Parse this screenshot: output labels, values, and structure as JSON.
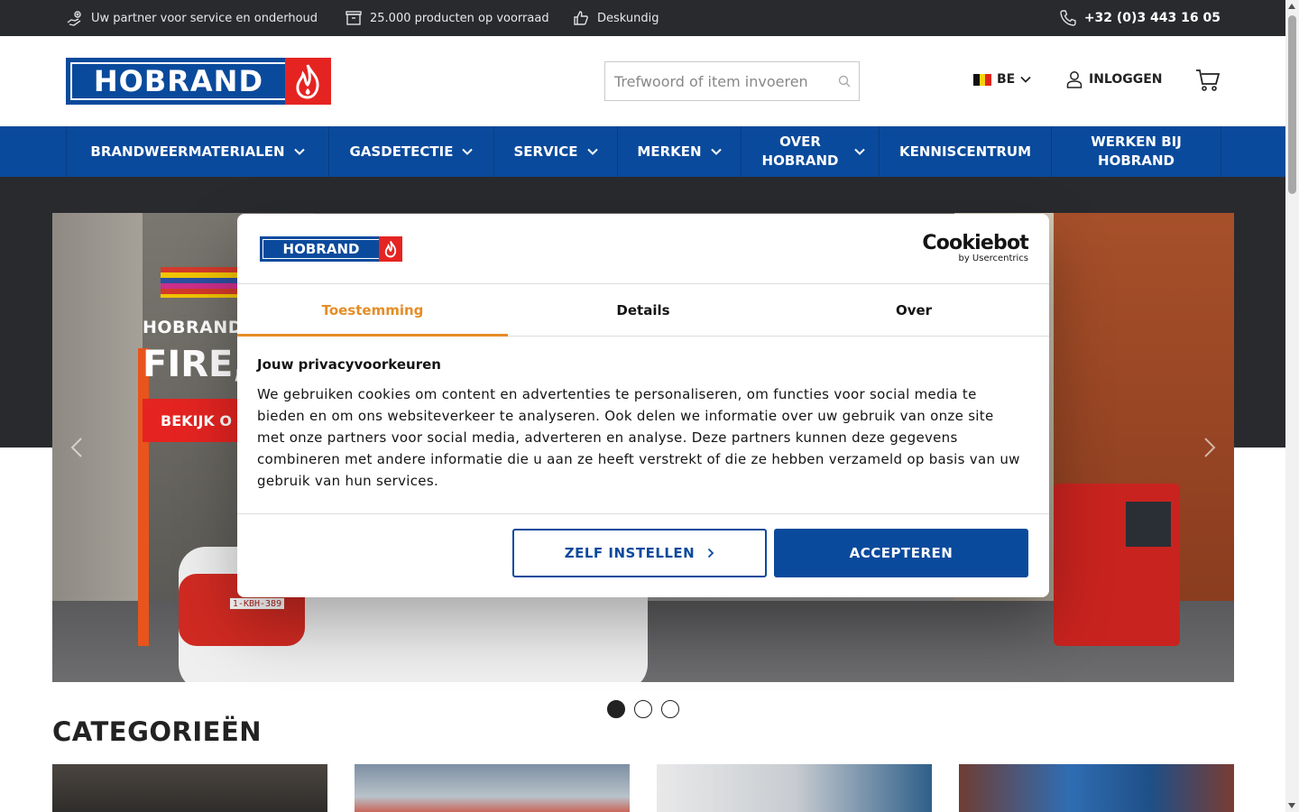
{
  "topbar": {
    "usp1": "Uw partner voor service en onderhoud",
    "usp2": "25.000 producten op voorraad",
    "usp3": "Deskundig",
    "phone": "+32 (0)3 443 16 05"
  },
  "header": {
    "logo_text": "HOBRAND",
    "search_placeholder": "Trefwoord of item invoeren",
    "language": "BE",
    "login": "INLOGGEN"
  },
  "nav": {
    "items": [
      {
        "label": "BRANDWEERMATERIALEN"
      },
      {
        "label": "GASDETECTIE"
      },
      {
        "label": "SERVICE"
      },
      {
        "label": "MERKEN"
      },
      {
        "label": "OVER HOBRAND"
      },
      {
        "label": "KENNISCENTRUM"
      },
      {
        "label": "WERKEN BIJ HOBRAND"
      }
    ]
  },
  "hero": {
    "kicker": "HOBRAND",
    "headline": "FIRE,",
    "cta": "BEKIJK O",
    "plate": "1-KBH-389",
    "slide_count": 3,
    "active_slide": 1
  },
  "categories": {
    "title": "CATEGORIEËN"
  },
  "cookie": {
    "logo_text": "HOBRAND",
    "brand_title": "Cookiebot",
    "brand_sub": "by Usercentrics",
    "tabs": [
      "Toestemming",
      "Details",
      "Over"
    ],
    "active_tab": "Toestemming",
    "heading": "Jouw privacyvoorkeuren",
    "text": "We gebruiken cookies om content en advertenties te personaliseren, om functies voor social media te bieden en om ons websiteverkeer te analyseren. Ook delen we informatie over uw gebruik van onze site met onze partners voor social media, adverteren en analyse. Deze partners kunnen deze gegevens combineren met andere informatie die u aan ze heeft verstrekt of die ze hebben verzameld op basis van uw gebruik van hun services.",
    "btn_secondary": "ZELF INSTELLEN",
    "btn_primary": "ACCEPTEREN"
  },
  "colors": {
    "brand_blue": "#0a4a9c",
    "brand_red": "#e52421",
    "topbar_bg": "#292a2e",
    "tab_active": "#e58d25"
  }
}
